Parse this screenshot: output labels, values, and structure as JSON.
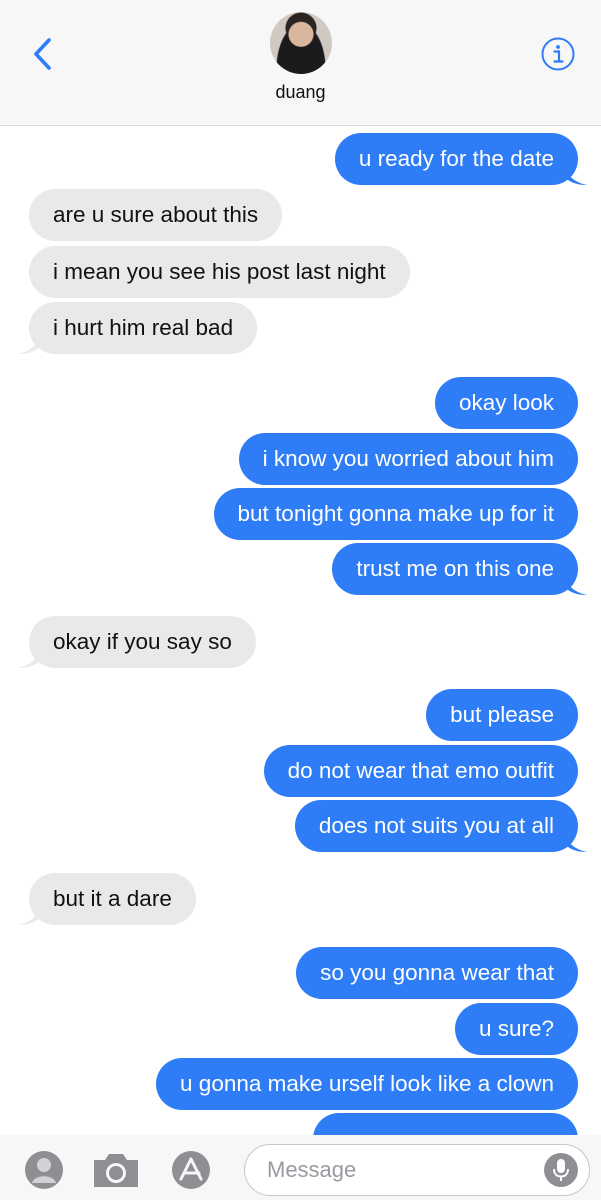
{
  "header": {
    "contact_name": "duang",
    "back_icon": "chevron-left-icon",
    "info_icon": "info-icon"
  },
  "colors": {
    "sent_bubble": "#2e7cf6",
    "received_bubble": "#e9e9eb",
    "accent": "#2e7cf6"
  },
  "messages": [
    {
      "direction": "sent",
      "text": "u ready for the date"
    },
    {
      "direction": "received",
      "text": "are u sure about this"
    },
    {
      "direction": "received",
      "text": "i mean you see his post last night"
    },
    {
      "direction": "received",
      "text": "i hurt him real bad"
    },
    {
      "direction": "sent",
      "text": "okay look"
    },
    {
      "direction": "sent",
      "text": "i know you worried about him"
    },
    {
      "direction": "sent",
      "text": "but tonight gonna make up for it"
    },
    {
      "direction": "sent",
      "text": "trust me on this one"
    },
    {
      "direction": "received",
      "text": "okay if you say so"
    },
    {
      "direction": "sent",
      "text": "but please"
    },
    {
      "direction": "sent",
      "text": "do not wear that emo outfit"
    },
    {
      "direction": "sent",
      "text": "does not suits you at all"
    },
    {
      "direction": "received",
      "text": "but it a dare"
    },
    {
      "direction": "sent",
      "text": "so you gonna wear that"
    },
    {
      "direction": "sent",
      "text": "u sure?"
    },
    {
      "direction": "sent",
      "text": "u gonna make urself look like a clown"
    }
  ],
  "composer": {
    "placeholder": "Message",
    "value": "",
    "icons": [
      "contacts-icon",
      "camera-icon",
      "app-store-icon",
      "microphone-icon"
    ]
  }
}
